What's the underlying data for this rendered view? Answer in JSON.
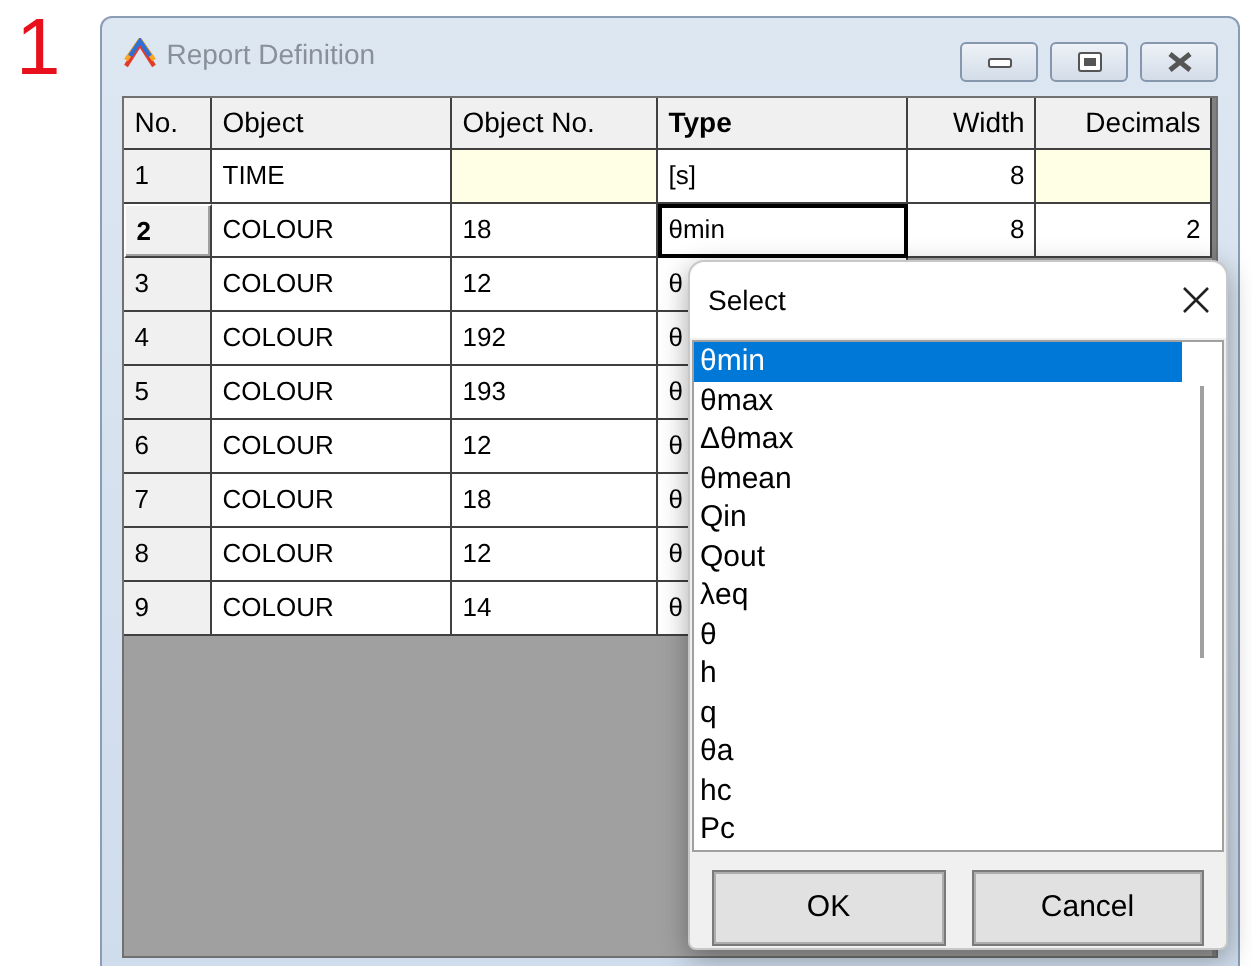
{
  "figure_label": "1",
  "window": {
    "title": "Report Definition"
  },
  "table": {
    "columns": [
      {
        "label": "No.",
        "kind": "text",
        "selected": false
      },
      {
        "label": "Object",
        "kind": "text",
        "selected": false
      },
      {
        "label": "Object No.",
        "kind": "text",
        "selected": false
      },
      {
        "label": "Type",
        "kind": "text",
        "selected": true
      },
      {
        "label": "Width",
        "kind": "number",
        "selected": false
      },
      {
        "label": "Decimals",
        "kind": "number",
        "selected": false
      }
    ],
    "rows": [
      {
        "selected": false,
        "cells": [
          {
            "kind": "header",
            "text": "1"
          },
          {
            "kind": "text",
            "text": "TIME"
          },
          {
            "kind": "disabled"
          },
          {
            "kind": "text",
            "text": "[s]"
          },
          {
            "kind": "text",
            "text": "8"
          },
          {
            "kind": "disabled"
          }
        ]
      },
      {
        "selected": true,
        "cells": [
          {
            "kind": "header",
            "text": "2"
          },
          {
            "kind": "text",
            "text": "COLOUR"
          },
          {
            "kind": "text",
            "text": "18"
          },
          {
            "kind": "text",
            "text": "θmin"
          },
          {
            "kind": "text",
            "text": "8"
          },
          {
            "kind": "text",
            "text": "2"
          }
        ]
      },
      {
        "selected": false,
        "cells": [
          {
            "kind": "header",
            "text": "3"
          },
          {
            "kind": "text",
            "text": "COLOUR"
          },
          {
            "kind": "text",
            "text": "12"
          },
          {
            "kind": "text",
            "text": "θ"
          }
        ]
      },
      {
        "selected": false,
        "cells": [
          {
            "kind": "header",
            "text": "4"
          },
          {
            "kind": "text",
            "text": "COLOUR"
          },
          {
            "kind": "text",
            "text": "192"
          },
          {
            "kind": "text",
            "text": "θ"
          }
        ]
      },
      {
        "selected": false,
        "cells": [
          {
            "kind": "header",
            "text": "5"
          },
          {
            "kind": "text",
            "text": "COLOUR"
          },
          {
            "kind": "text",
            "text": "193"
          },
          {
            "kind": "text",
            "text": "θ"
          }
        ]
      },
      {
        "selected": false,
        "cells": [
          {
            "kind": "header",
            "text": "6"
          },
          {
            "kind": "text",
            "text": "COLOUR"
          },
          {
            "kind": "text",
            "text": "12"
          },
          {
            "kind": "text",
            "text": "θ"
          }
        ]
      },
      {
        "selected": false,
        "cells": [
          {
            "kind": "header",
            "text": "7"
          },
          {
            "kind": "text",
            "text": "COLOUR"
          },
          {
            "kind": "text",
            "text": "18"
          },
          {
            "kind": "text",
            "text": "θ"
          }
        ]
      },
      {
        "selected": false,
        "cells": [
          {
            "kind": "header",
            "text": "8"
          },
          {
            "kind": "text",
            "text": "COLOUR"
          },
          {
            "kind": "text",
            "text": "12"
          },
          {
            "kind": "text",
            "text": "θ"
          }
        ]
      },
      {
        "selected": false,
        "cells": [
          {
            "kind": "header",
            "text": "9"
          },
          {
            "kind": "text",
            "text": "COLOUR"
          },
          {
            "kind": "text",
            "text": "14"
          },
          {
            "kind": "text",
            "text": "θ"
          }
        ]
      }
    ]
  },
  "dialog": {
    "title": "Select",
    "items": [
      {
        "label": "θmin",
        "selected": true
      },
      {
        "label": "θmax",
        "selected": false
      },
      {
        "label": "Δθmax",
        "selected": false
      },
      {
        "label": "θmean",
        "selected": false
      },
      {
        "label": "Qin",
        "selected": false
      },
      {
        "label": "Qout",
        "selected": false
      },
      {
        "label": "λeq",
        "selected": false
      },
      {
        "label": "θ",
        "selected": false
      },
      {
        "label": "h",
        "selected": false
      },
      {
        "label": "q",
        "selected": false
      },
      {
        "label": "θa",
        "selected": false
      },
      {
        "label": "hc",
        "selected": false
      },
      {
        "label": "Pc",
        "selected": false
      }
    ],
    "buttons": [
      "OK",
      "Cancel"
    ]
  }
}
